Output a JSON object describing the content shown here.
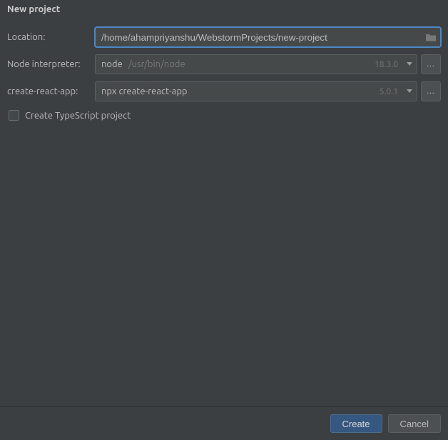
{
  "title": "New project",
  "form": {
    "location": {
      "label": "Location:",
      "value": "/home/ahampriyanshu/WebstormProjects/new-project"
    },
    "interpreter": {
      "label": "Node interpreter:",
      "primary": "node",
      "secondary": "/usr/bin/node",
      "version": "18.3.0"
    },
    "cra": {
      "label": "create-react-app:",
      "primary": "npx create-react-app",
      "version": "5.0.1"
    },
    "typescript": {
      "label": "Create TypeScript project",
      "checked": false
    }
  },
  "buttons": {
    "ellipsis": "...",
    "create": "Create",
    "cancel": "Cancel"
  }
}
